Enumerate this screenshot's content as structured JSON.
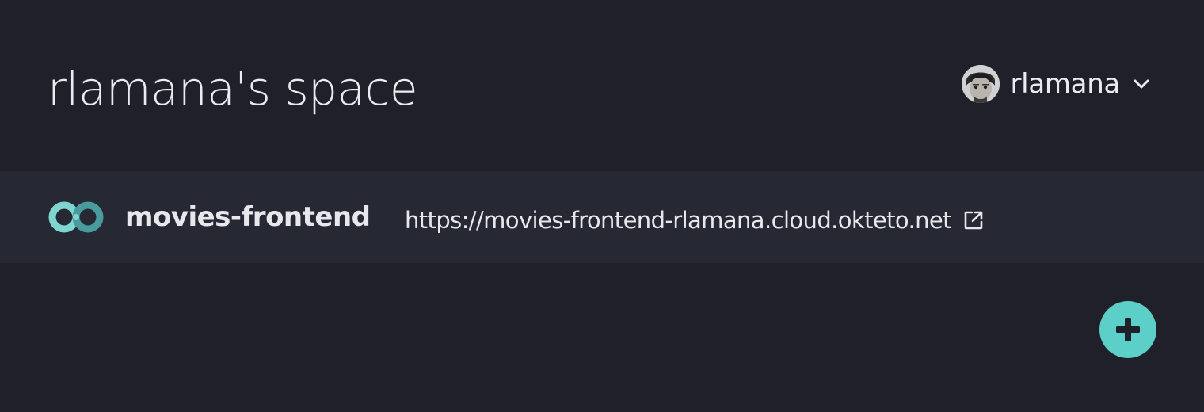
{
  "header": {
    "title": "rlamana's space"
  },
  "user": {
    "name": "rlamana",
    "avatar_icon": "user-avatar",
    "menu_icon": "chevron-down-icon"
  },
  "apps": [
    {
      "name": "movies-frontend",
      "url": "https://movies-frontend-rlamana.cloud.okteto.net",
      "logo_icon": "okteto-logo-icon",
      "link_icon": "external-link-icon"
    }
  ],
  "actions": {
    "add_icon": "plus-icon"
  },
  "colors": {
    "background": "#1f2029",
    "row_background": "#262834",
    "accent": "#5ccfc8",
    "text": "#e6e8ec"
  }
}
